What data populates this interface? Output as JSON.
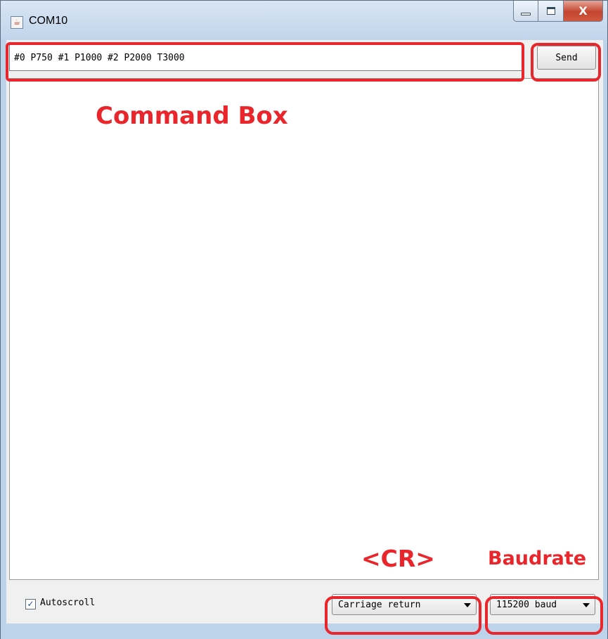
{
  "window": {
    "title": "COM10",
    "icon": "java-cup-icon",
    "controls": {
      "minimize": "minimize-icon",
      "maximize": "maximize-icon",
      "close_glyph": "X"
    }
  },
  "command": {
    "value": "#0 P750 #1 P1000 #2 P2000 T3000",
    "send_label": "Send"
  },
  "footer": {
    "autoscroll_label": "Autoscroll",
    "autoscroll_checked": true,
    "line_ending": "Carriage return",
    "baud": "115200 baud"
  },
  "annotations": {
    "command_box": "Command Box",
    "cr": "<CR>",
    "baudrate": "Baudrate",
    "color": "#e8262c"
  }
}
